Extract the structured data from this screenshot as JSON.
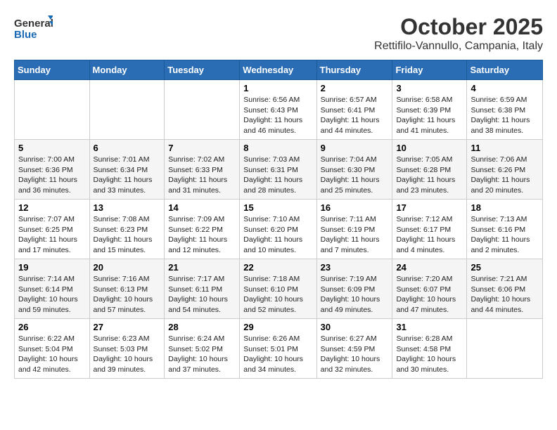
{
  "header": {
    "logo_general": "General",
    "logo_blue": "Blue",
    "month_title": "October 2025",
    "location": "Rettifilo-Vannullo, Campania, Italy"
  },
  "days_of_week": [
    "Sunday",
    "Monday",
    "Tuesday",
    "Wednesday",
    "Thursday",
    "Friday",
    "Saturday"
  ],
  "weeks": [
    [
      {
        "day": "",
        "info": ""
      },
      {
        "day": "",
        "info": ""
      },
      {
        "day": "",
        "info": ""
      },
      {
        "day": "1",
        "info": "Sunrise: 6:56 AM\nSunset: 6:43 PM\nDaylight: 11 hours and 46 minutes."
      },
      {
        "day": "2",
        "info": "Sunrise: 6:57 AM\nSunset: 6:41 PM\nDaylight: 11 hours and 44 minutes."
      },
      {
        "day": "3",
        "info": "Sunrise: 6:58 AM\nSunset: 6:39 PM\nDaylight: 11 hours and 41 minutes."
      },
      {
        "day": "4",
        "info": "Sunrise: 6:59 AM\nSunset: 6:38 PM\nDaylight: 11 hours and 38 minutes."
      }
    ],
    [
      {
        "day": "5",
        "info": "Sunrise: 7:00 AM\nSunset: 6:36 PM\nDaylight: 11 hours and 36 minutes."
      },
      {
        "day": "6",
        "info": "Sunrise: 7:01 AM\nSunset: 6:34 PM\nDaylight: 11 hours and 33 minutes."
      },
      {
        "day": "7",
        "info": "Sunrise: 7:02 AM\nSunset: 6:33 PM\nDaylight: 11 hours and 31 minutes."
      },
      {
        "day": "8",
        "info": "Sunrise: 7:03 AM\nSunset: 6:31 PM\nDaylight: 11 hours and 28 minutes."
      },
      {
        "day": "9",
        "info": "Sunrise: 7:04 AM\nSunset: 6:30 PM\nDaylight: 11 hours and 25 minutes."
      },
      {
        "day": "10",
        "info": "Sunrise: 7:05 AM\nSunset: 6:28 PM\nDaylight: 11 hours and 23 minutes."
      },
      {
        "day": "11",
        "info": "Sunrise: 7:06 AM\nSunset: 6:26 PM\nDaylight: 11 hours and 20 minutes."
      }
    ],
    [
      {
        "day": "12",
        "info": "Sunrise: 7:07 AM\nSunset: 6:25 PM\nDaylight: 11 hours and 17 minutes."
      },
      {
        "day": "13",
        "info": "Sunrise: 7:08 AM\nSunset: 6:23 PM\nDaylight: 11 hours and 15 minutes."
      },
      {
        "day": "14",
        "info": "Sunrise: 7:09 AM\nSunset: 6:22 PM\nDaylight: 11 hours and 12 minutes."
      },
      {
        "day": "15",
        "info": "Sunrise: 7:10 AM\nSunset: 6:20 PM\nDaylight: 11 hours and 10 minutes."
      },
      {
        "day": "16",
        "info": "Sunrise: 7:11 AM\nSunset: 6:19 PM\nDaylight: 11 hours and 7 minutes."
      },
      {
        "day": "17",
        "info": "Sunrise: 7:12 AM\nSunset: 6:17 PM\nDaylight: 11 hours and 4 minutes."
      },
      {
        "day": "18",
        "info": "Sunrise: 7:13 AM\nSunset: 6:16 PM\nDaylight: 11 hours and 2 minutes."
      }
    ],
    [
      {
        "day": "19",
        "info": "Sunrise: 7:14 AM\nSunset: 6:14 PM\nDaylight: 10 hours and 59 minutes."
      },
      {
        "day": "20",
        "info": "Sunrise: 7:16 AM\nSunset: 6:13 PM\nDaylight: 10 hours and 57 minutes."
      },
      {
        "day": "21",
        "info": "Sunrise: 7:17 AM\nSunset: 6:11 PM\nDaylight: 10 hours and 54 minutes."
      },
      {
        "day": "22",
        "info": "Sunrise: 7:18 AM\nSunset: 6:10 PM\nDaylight: 10 hours and 52 minutes."
      },
      {
        "day": "23",
        "info": "Sunrise: 7:19 AM\nSunset: 6:09 PM\nDaylight: 10 hours and 49 minutes."
      },
      {
        "day": "24",
        "info": "Sunrise: 7:20 AM\nSunset: 6:07 PM\nDaylight: 10 hours and 47 minutes."
      },
      {
        "day": "25",
        "info": "Sunrise: 7:21 AM\nSunset: 6:06 PM\nDaylight: 10 hours and 44 minutes."
      }
    ],
    [
      {
        "day": "26",
        "info": "Sunrise: 6:22 AM\nSunset: 5:04 PM\nDaylight: 10 hours and 42 minutes."
      },
      {
        "day": "27",
        "info": "Sunrise: 6:23 AM\nSunset: 5:03 PM\nDaylight: 10 hours and 39 minutes."
      },
      {
        "day": "28",
        "info": "Sunrise: 6:24 AM\nSunset: 5:02 PM\nDaylight: 10 hours and 37 minutes."
      },
      {
        "day": "29",
        "info": "Sunrise: 6:26 AM\nSunset: 5:01 PM\nDaylight: 10 hours and 34 minutes."
      },
      {
        "day": "30",
        "info": "Sunrise: 6:27 AM\nSunset: 4:59 PM\nDaylight: 10 hours and 32 minutes."
      },
      {
        "day": "31",
        "info": "Sunrise: 6:28 AM\nSunset: 4:58 PM\nDaylight: 10 hours and 30 minutes."
      },
      {
        "day": "",
        "info": ""
      }
    ]
  ]
}
